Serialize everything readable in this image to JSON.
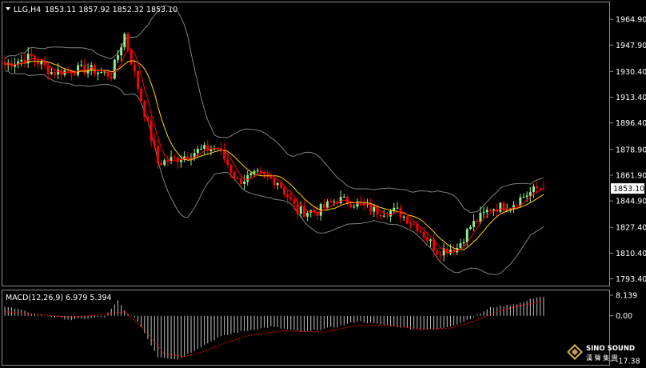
{
  "header": {
    "symbol_timeframe": "LLG,H4",
    "ohlc_values": "1853.11 1857.92 1852.32 1853.10"
  },
  "price_axis": {
    "ticks": [
      "1964.90",
      "1947.90",
      "1930.40",
      "1913.40",
      "1896.40",
      "1878.90",
      "1861.90",
      "1844.90",
      "1827.40",
      "1810.40",
      "1793.40"
    ],
    "current_price_label": "1853.10"
  },
  "macd": {
    "label": "MACD(12,26,9) 6.979 5.394",
    "ticks": [
      "8.139",
      "0.00",
      "-17.38"
    ]
  },
  "logo": {
    "line1": "SINO SOUND",
    "line2": "漢 聲 集 團"
  },
  "colors": {
    "background": "#000000",
    "bull_candle": "#90EE90",
    "bear_candle": "#FF0000",
    "ma_fast": "#FF0000",
    "ma_slow": "#FFD700",
    "bands": "#808080",
    "macd_hist": "#C0C0C0",
    "macd_signal": "#FF0000"
  },
  "chart_data": [
    {
      "type": "candlestick",
      "title": "LLG,H4",
      "ylim": [
        1790,
        1975
      ],
      "y_ticks": [
        1964.9,
        1947.9,
        1930.4,
        1913.4,
        1896.4,
        1878.9,
        1861.9,
        1844.9,
        1827.4,
        1810.4,
        1793.4
      ],
      "current_price": 1853.1,
      "last_bar": {
        "open": 1853.11,
        "high": 1857.92,
        "low": 1852.32,
        "close": 1853.1
      },
      "close_trend_keypoints": [
        [
          0,
          1935
        ],
        [
          8,
          1940
        ],
        [
          14,
          1930
        ],
        [
          25,
          1932
        ],
        [
          32,
          1928
        ],
        [
          36,
          1955
        ],
        [
          40,
          1920
        ],
        [
          46,
          1870
        ],
        [
          52,
          1873
        ],
        [
          58,
          1878
        ],
        [
          64,
          1880
        ],
        [
          70,
          1858
        ],
        [
          76,
          1862
        ],
        [
          82,
          1858
        ],
        [
          88,
          1838
        ],
        [
          94,
          1838
        ],
        [
          100,
          1846
        ],
        [
          106,
          1843
        ],
        [
          112,
          1838
        ],
        [
          118,
          1838
        ],
        [
          124,
          1828
        ],
        [
          130,
          1812
        ],
        [
          136,
          1814
        ],
        [
          140,
          1828
        ],
        [
          146,
          1840
        ],
        [
          152,
          1842
        ],
        [
          156,
          1848
        ],
        [
          160,
          1853
        ],
        [
          162,
          1853.1
        ]
      ],
      "overlays": [
        "fast moving average (red)",
        "slow moving average (yellow)",
        "upper band (gray)",
        "lower band (gray)"
      ],
      "grid": false
    },
    {
      "type": "bar",
      "title": "MACD(12,26,9)",
      "macd_value": 6.979,
      "signal_value": 5.394,
      "ylim": [
        -17.38,
        8.139
      ],
      "y_ticks": [
        8.139,
        0,
        -17.38
      ],
      "histogram_keypoints": [
        [
          0,
          3.5
        ],
        [
          10,
          0.5
        ],
        [
          20,
          -1.5
        ],
        [
          30,
          -0.5
        ],
        [
          34,
          5.5
        ],
        [
          36,
          2
        ],
        [
          40,
          -2
        ],
        [
          46,
          -15
        ],
        [
          52,
          -16
        ],
        [
          58,
          -12
        ],
        [
          64,
          -8
        ],
        [
          70,
          -6
        ],
        [
          80,
          -4
        ],
        [
          90,
          -6
        ],
        [
          100,
          -4
        ],
        [
          106,
          -2
        ],
        [
          112,
          -3
        ],
        [
          118,
          -4
        ],
        [
          124,
          -5
        ],
        [
          130,
          -5
        ],
        [
          136,
          -3
        ],
        [
          140,
          -1
        ],
        [
          146,
          3
        ],
        [
          152,
          4
        ],
        [
          156,
          5
        ],
        [
          160,
          6.979
        ],
        [
          162,
          6.979
        ]
      ],
      "signal_keypoints": [
        [
          0,
          1.5
        ],
        [
          10,
          0.5
        ],
        [
          20,
          -0.5
        ],
        [
          30,
          0.5
        ],
        [
          36,
          1.5
        ],
        [
          42,
          -5
        ],
        [
          48,
          -14
        ],
        [
          54,
          -15
        ],
        [
          60,
          -13
        ],
        [
          66,
          -10
        ],
        [
          74,
          -7
        ],
        [
          84,
          -5.5
        ],
        [
          96,
          -6
        ],
        [
          106,
          -3.5
        ],
        [
          116,
          -3.5
        ],
        [
          126,
          -5
        ],
        [
          134,
          -4.5
        ],
        [
          140,
          -2.5
        ],
        [
          148,
          1.5
        ],
        [
          154,
          3.5
        ],
        [
          162,
          5.394
        ]
      ]
    }
  ]
}
